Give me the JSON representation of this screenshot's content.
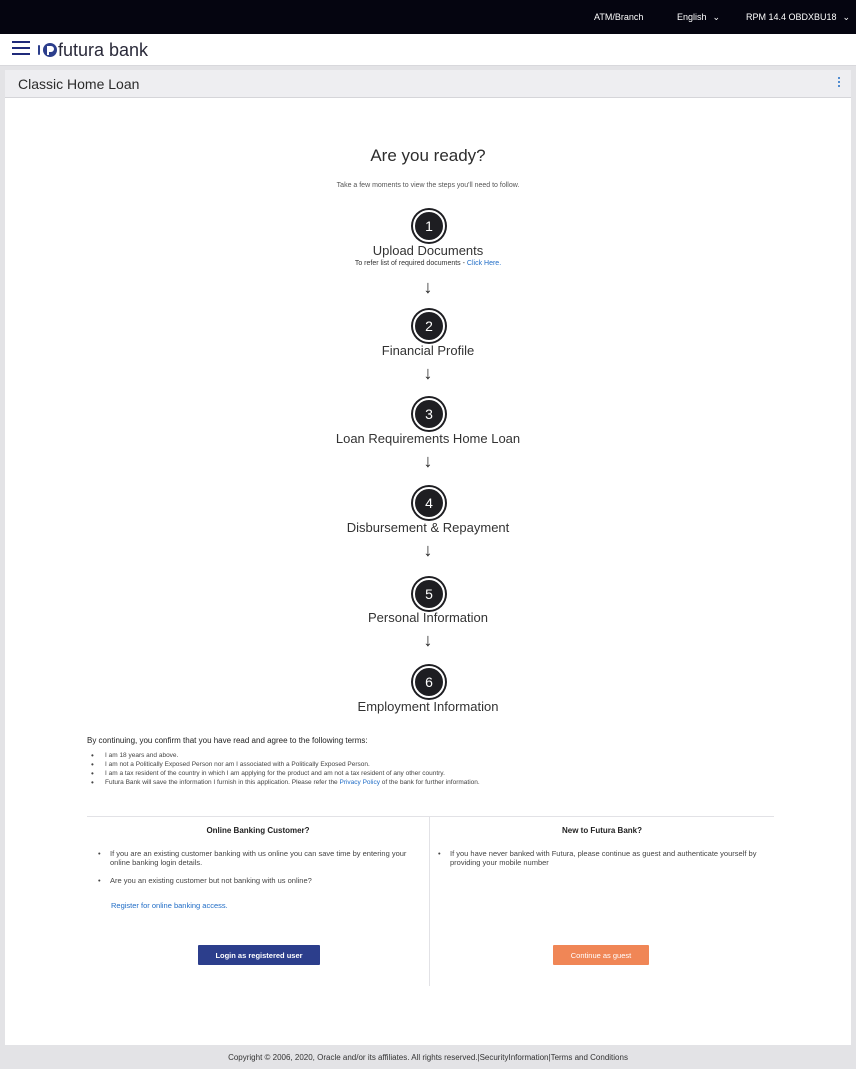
{
  "topbar": {
    "atm_branch": "ATM/Branch",
    "language": "English",
    "user": "RPM 14.4 OBDXBU18"
  },
  "header": {
    "logo_text": "futura bank"
  },
  "page": {
    "title": "Classic Home Loan"
  },
  "intro": {
    "title": "Are you ready?",
    "subtitle": "Take a few moments to view the steps you'll need to follow."
  },
  "steps": [
    {
      "number": "1",
      "label": "Upload Documents",
      "note_prefix": "To refer list of required documents - ",
      "note_link": "Click Here."
    },
    {
      "number": "2",
      "label": "Financial Profile"
    },
    {
      "number": "3",
      "label": "Loan Requirements Home Loan"
    },
    {
      "number": "4",
      "label": "Disbursement & Repayment"
    },
    {
      "number": "5",
      "label": "Personal Information"
    },
    {
      "number": "6",
      "label": "Employment Information"
    }
  ],
  "terms": {
    "heading": "By continuing, you confirm that you have read and agree to the following terms:",
    "items": [
      "I am 18 years and above.",
      "I am not a Politically Exposed Person nor am I associated with a Politically Exposed Person.",
      "I am a tax resident of the country in which I am applying for the product and am not a tax resident of any other country."
    ],
    "last_item_prefix": "Futura Bank will save the information I furnish in this application. Please refer the ",
    "last_item_link": "Privacy Policy",
    "last_item_suffix": " of the bank for further information."
  },
  "online_customer": {
    "title": "Online Banking Customer?",
    "items": [
      "If you are an existing customer banking with us online you can save time by entering your online banking login details.",
      "Are you an existing customer but not banking with us online?"
    ],
    "register_link": "Register for online banking access.",
    "login_button": "Login as registered user"
  },
  "new_customer": {
    "title": "New to Futura Bank?",
    "items": [
      "If you have never banked with Futura, please continue as guest and authenticate yourself by providing your mobile number"
    ],
    "guest_button": "Continue as guest"
  },
  "footer": {
    "copyright": "Copyright © 2006, 2020, Oracle and/or its affiliates. All rights reserved.|SecurityInformation|Terms and Conditions"
  },
  "colors": {
    "topbar_bg": "#050510",
    "primary_button": "#2c3e8c",
    "guest_button": "#f08656",
    "link": "#1f6cc6"
  }
}
